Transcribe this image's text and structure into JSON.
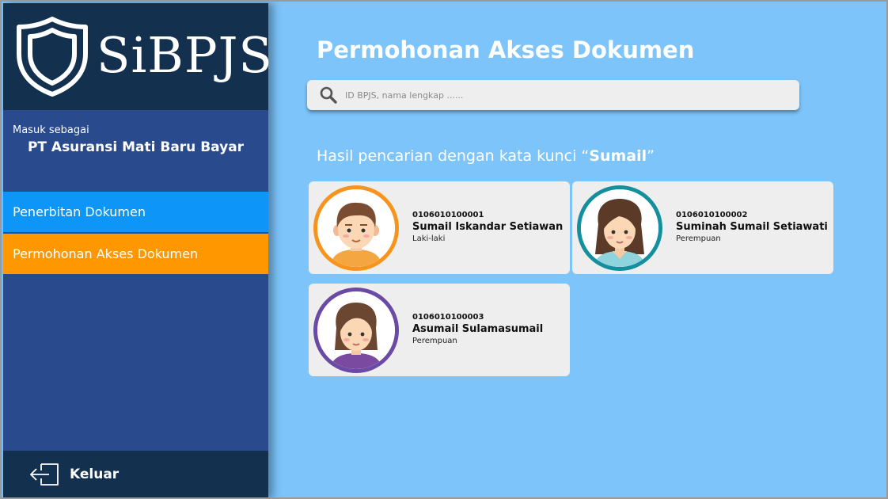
{
  "app": {
    "logo_text": "SiBPJS"
  },
  "sidebar": {
    "login_label": "Masuk sebagai",
    "company": "PT Asuransi Mati Baru Bayar",
    "items": [
      {
        "label": "Penerbitan Dokumen",
        "color": "#0d96f7"
      },
      {
        "label": "Permohonan Akses Dokumen",
        "color": "#ff9800",
        "active": true
      }
    ],
    "logout_label": "Keluar"
  },
  "main": {
    "title": "Permohonan Akses Dokumen",
    "search": {
      "placeholder": "ID BPJS, nama lengkap ......",
      "value": ""
    },
    "result_prefix": "Hasil pencarian dengan kata kunci “",
    "result_keyword": "Sumail",
    "result_suffix": "”",
    "results": [
      {
        "id": "0106010100001",
        "name": "Sumail Iskandar Setiawan",
        "gender": "Laki-laki",
        "ring_color": "#f7941d"
      },
      {
        "id": "0106010100002",
        "name": "Suminah Sumail Setiawati",
        "gender": "Perempuan",
        "ring_color": "#138f9e"
      },
      {
        "id": "0106010100003",
        "name": "Asumail Sulamasumail",
        "gender": "Perempuan",
        "ring_color": "#6a4aa5"
      }
    ]
  },
  "colors": {
    "background": "#7cc4fa",
    "sidebar": "#294a8c",
    "sidebar_dark": "#14304f"
  }
}
